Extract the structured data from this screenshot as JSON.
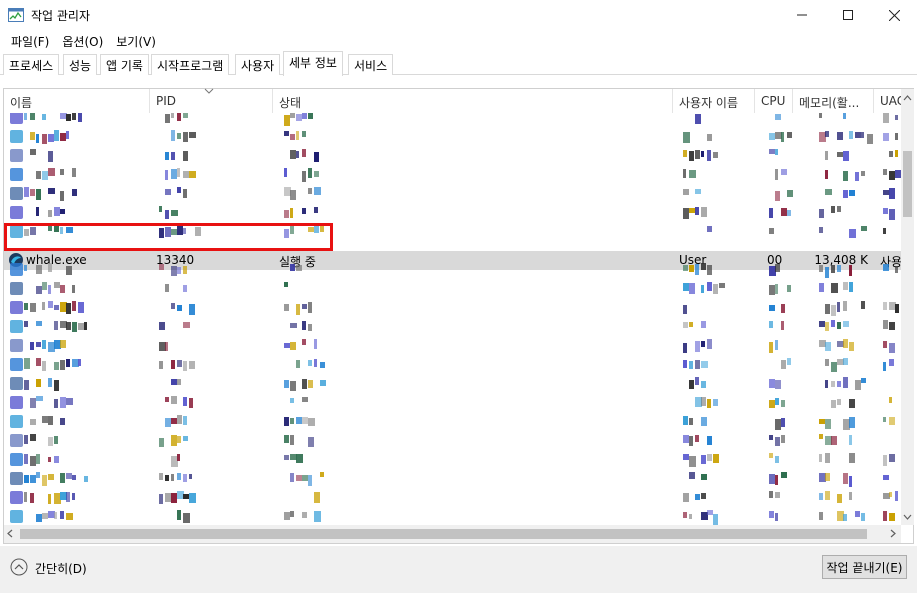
{
  "window": {
    "title": "작업 관리자",
    "icon": "task-manager-icon"
  },
  "menu": [
    {
      "label": "파일(F)"
    },
    {
      "label": "옵션(O)"
    },
    {
      "label": "보기(V)"
    }
  ],
  "tabs": [
    {
      "label": "프로세스"
    },
    {
      "label": "성능"
    },
    {
      "label": "앱 기록"
    },
    {
      "label": "시작프로그램"
    },
    {
      "label": "사용자"
    },
    {
      "label": "세부 정보",
      "active": true
    },
    {
      "label": "서비스"
    }
  ],
  "columns": [
    {
      "label": "이름"
    },
    {
      "label": "PID"
    },
    {
      "label": "상태"
    },
    {
      "label": "사용자 이름"
    },
    {
      "label": "CPU"
    },
    {
      "label": "메모리(활..."
    },
    {
      "label": "UAC"
    }
  ],
  "selected_row": {
    "name": "whale.exe",
    "pid": "13340",
    "status": "실행 중",
    "user": "User",
    "cpu": "00",
    "memory": "13,408 K",
    "uac": "사용"
  },
  "footer": {
    "fewer_details": "간단히(D)",
    "end_task": "작업 끝내기(E)"
  },
  "colors": {
    "highlight": "#e81111",
    "selected_row": "#d9d9d9"
  }
}
